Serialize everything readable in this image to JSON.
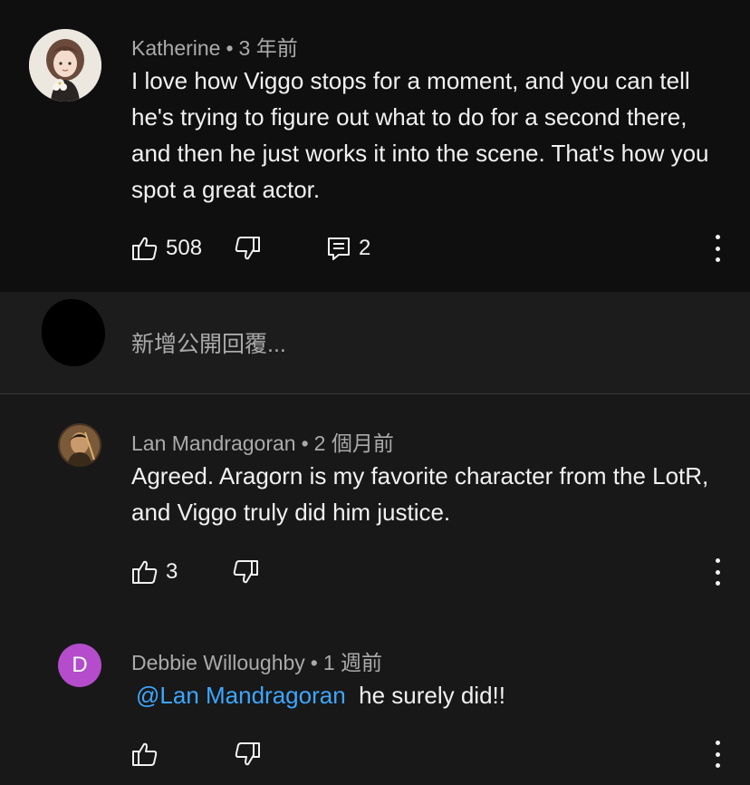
{
  "top_comment": {
    "author": "Katherine",
    "time": "3 年前",
    "text": "I love how Viggo stops for a moment, and you can tell he's trying to figure out what to do for a second there, and then he just works it into the scene. That's how you spot a great actor.",
    "likes": "508",
    "replies": "2"
  },
  "reply_input": {
    "placeholder": "新增公開回覆..."
  },
  "replies": [
    {
      "author": "Lan Mandragoran",
      "time": "2 個月前",
      "text": "Agreed. Aragorn is my favorite character from the LotR, and Viggo truly did him justice.",
      "likes": "3"
    },
    {
      "author": "Debbie Willoughby",
      "avatar_letter": "D",
      "avatar_color": "#b44ccb",
      "time": "1 週前",
      "mention": "@Lan Mandragoran",
      "text": "he surely did!!"
    }
  ],
  "separator": "•",
  "colors": {
    "background": "#181818",
    "top_background": "#0f0f0f",
    "link": "#3ea6ff",
    "secondary_text": "#aaaaaa"
  },
  "icons": [
    "thumb-up-icon",
    "thumb-down-icon",
    "comment-icon",
    "more-vert-icon"
  ]
}
